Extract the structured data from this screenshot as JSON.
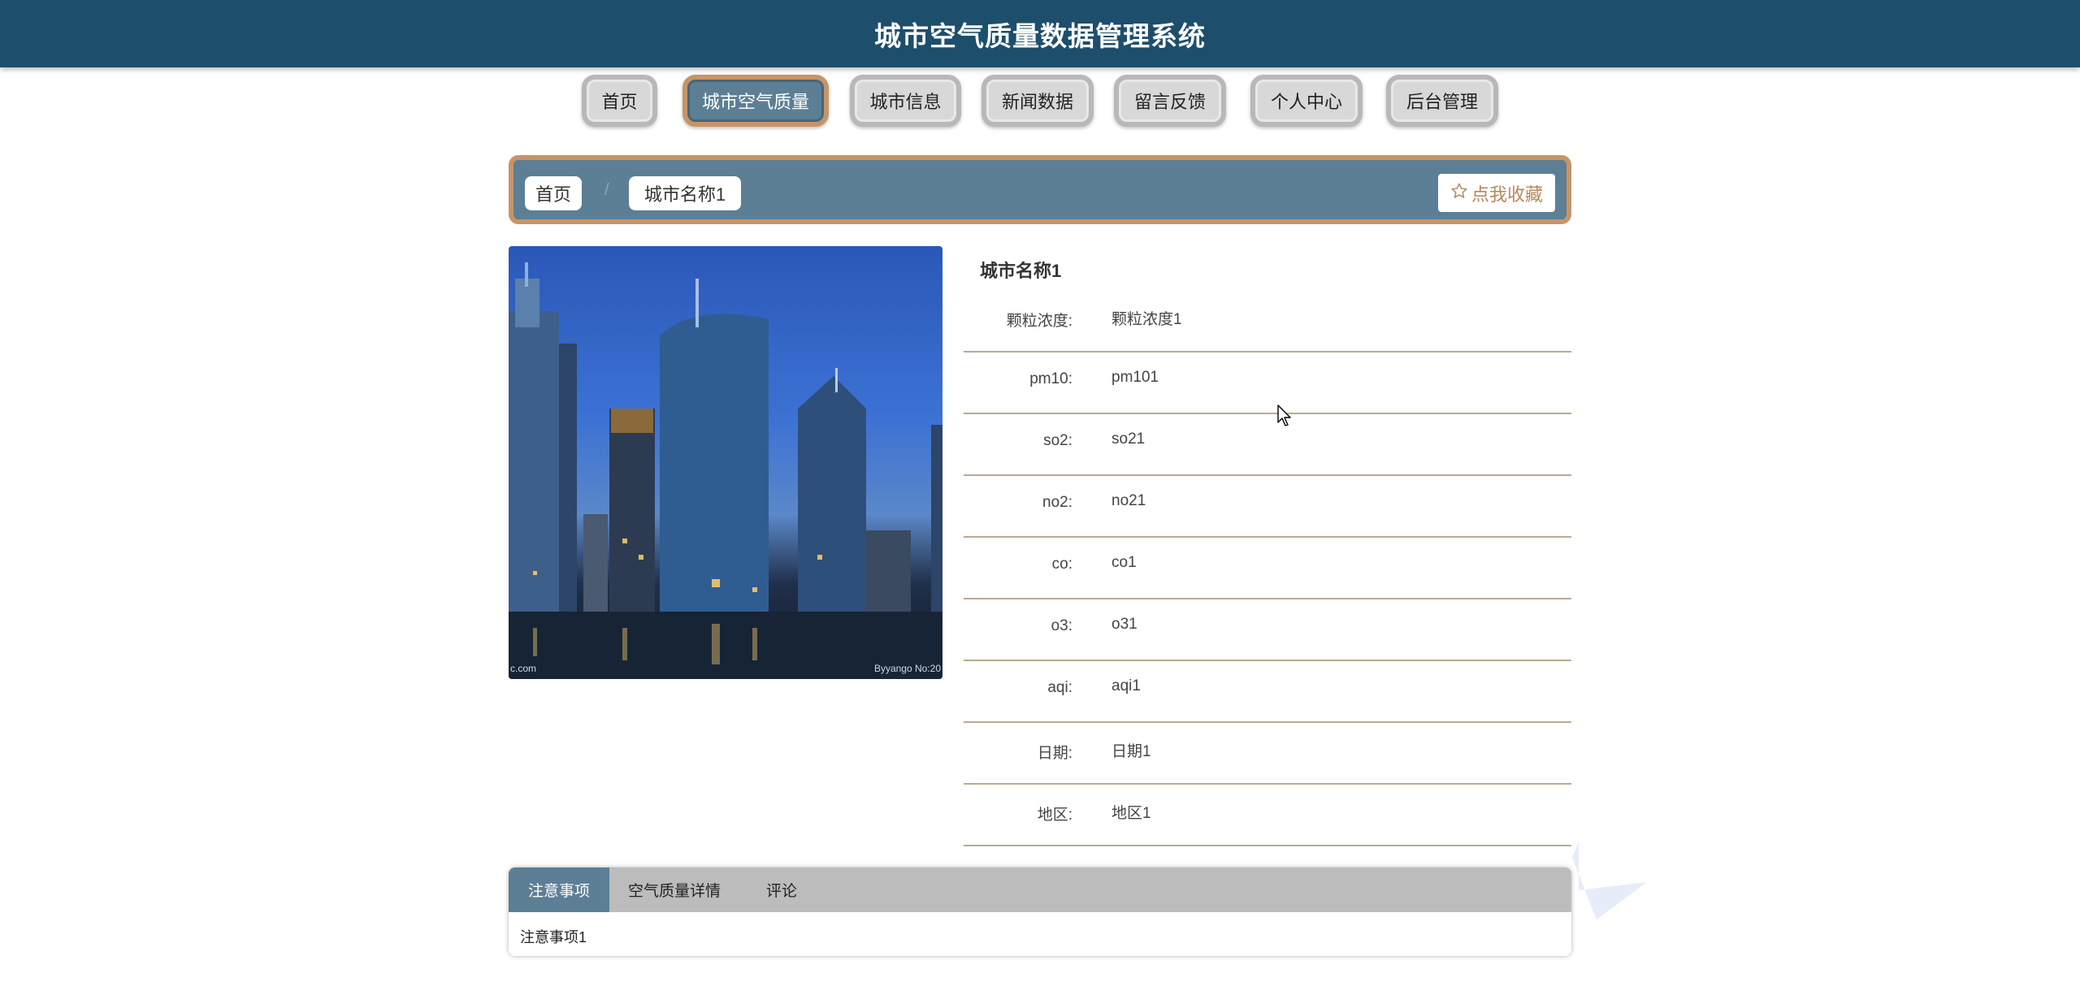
{
  "header": {
    "title": "城市空气质量数据管理系统"
  },
  "nav": {
    "items": [
      {
        "label": "首页"
      },
      {
        "label": "城市空气质量"
      },
      {
        "label": "城市信息"
      },
      {
        "label": "新闻数据"
      },
      {
        "label": "留言反馈"
      },
      {
        "label": "个人中心"
      },
      {
        "label": "后台管理"
      }
    ],
    "active": "城市空气质量"
  },
  "breadcrumb": {
    "home": "首页",
    "separator": "/",
    "current": "城市名称1"
  },
  "favorite": {
    "icon": "star-outline-icon",
    "label": "点我收藏"
  },
  "photo": {
    "description_icon": "city-skyline-image",
    "watermark_left": "c.com",
    "watermark_right": "Byyango No:20"
  },
  "detail": {
    "title": "城市名称1",
    "rows": [
      {
        "label": "颗粒浓度:",
        "value": "颗粒浓度1"
      },
      {
        "label": "pm10:",
        "value": "pm101"
      },
      {
        "label": "so2:",
        "value": "so21"
      },
      {
        "label": "no2:",
        "value": "no21"
      },
      {
        "label": "co:",
        "value": "co1"
      },
      {
        "label": "o3:",
        "value": "o31"
      },
      {
        "label": "aqi:",
        "value": "aqi1"
      },
      {
        "label": "日期:",
        "value": "日期1"
      },
      {
        "label": "地区:",
        "value": "地区1"
      }
    ]
  },
  "tabs": {
    "items": [
      {
        "label": "注意事项"
      },
      {
        "label": "空气质量详情"
      },
      {
        "label": "评论"
      }
    ],
    "active": "注意事项",
    "content": "注意事项1"
  },
  "colors": {
    "header_bg": "#1d4e6c",
    "accent": "#5c7f95",
    "border_accent": "#c79466",
    "row_divider": "#b9ab90"
  }
}
